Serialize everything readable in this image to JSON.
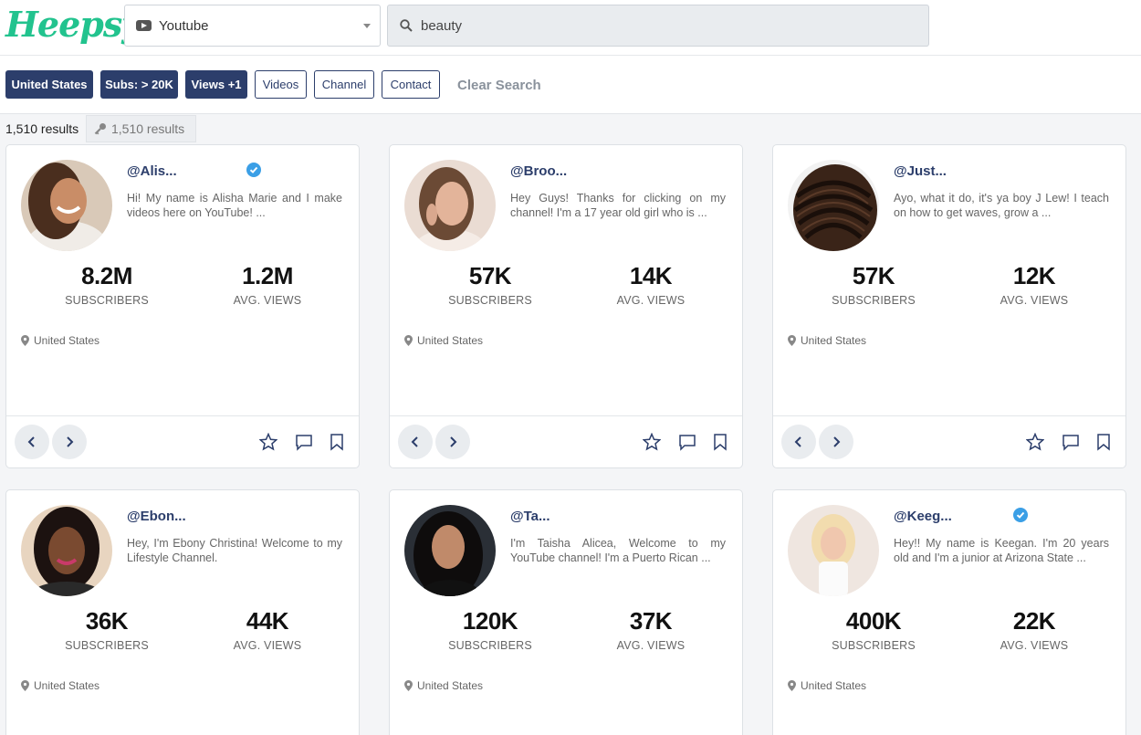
{
  "header": {
    "logo": "Heepsy",
    "platform": "Youtube",
    "search_value": "beauty"
  },
  "filters": {
    "country": "United States",
    "subs": "Subs: > 20K",
    "views": "Views +1",
    "videos": "Videos",
    "channel": "Channel",
    "contact": "Contact",
    "clear": "Clear Search"
  },
  "results": {
    "count": "1,510 results",
    "locked_count": "1,510 results"
  },
  "colors": {
    "accent": "#2c3e6b",
    "logo": "#22c38e",
    "verified": "#3b9fe6"
  },
  "cards": [
    {
      "handle": "@Alis...",
      "verified": true,
      "bio": "Hi! My name is Alisha Marie and I make videos here on YouTube! ...",
      "subscribers": "8.2M",
      "subscribers_label": "SUBSCRIBERS",
      "avg_views": "1.2M",
      "avg_views_label": "AVG. VIEWS",
      "location": "United States"
    },
    {
      "handle": "@Broo...",
      "verified": false,
      "bio": "Hey Guys! Thanks for clicking on my channel! I'm a 17 year old girl who is ...",
      "subscribers": "57K",
      "subscribers_label": "SUBSCRIBERS",
      "avg_views": "14K",
      "avg_views_label": "AVG. VIEWS",
      "location": "United States"
    },
    {
      "handle": "@Just...",
      "verified": false,
      "bio": "Ayo, what it do, it's ya boy J Lew! I teach on how to get waves, grow a ...",
      "subscribers": "57K",
      "subscribers_label": "SUBSCRIBERS",
      "avg_views": "12K",
      "avg_views_label": "AVG. VIEWS",
      "location": "United States"
    },
    {
      "handle": "@Ebon...",
      "verified": false,
      "bio": "Hey, I'm Ebony Christina! Welcome to my Lifestyle Channel.",
      "subscribers": "36K",
      "subscribers_label": "SUBSCRIBERS",
      "avg_views": "44K",
      "avg_views_label": "AVG. VIEWS",
      "location": "United States"
    },
    {
      "handle": "@Ta...",
      "verified": false,
      "bio": "I'm Taisha Alicea, Welcome to my YouTube channel! I'm a Puerto Rican ...",
      "subscribers": "120K",
      "subscribers_label": "SUBSCRIBERS",
      "avg_views": "37K",
      "avg_views_label": "AVG. VIEWS",
      "location": "United States"
    },
    {
      "handle": "@Keeg...",
      "verified": true,
      "bio": "Hey!! My name is Keegan. I'm 20 years old and I'm a junior at Arizona State ...",
      "subscribers": "400K",
      "subscribers_label": "SUBSCRIBERS",
      "avg_views": "22K",
      "avg_views_label": "AVG. VIEWS",
      "location": "United States"
    }
  ]
}
